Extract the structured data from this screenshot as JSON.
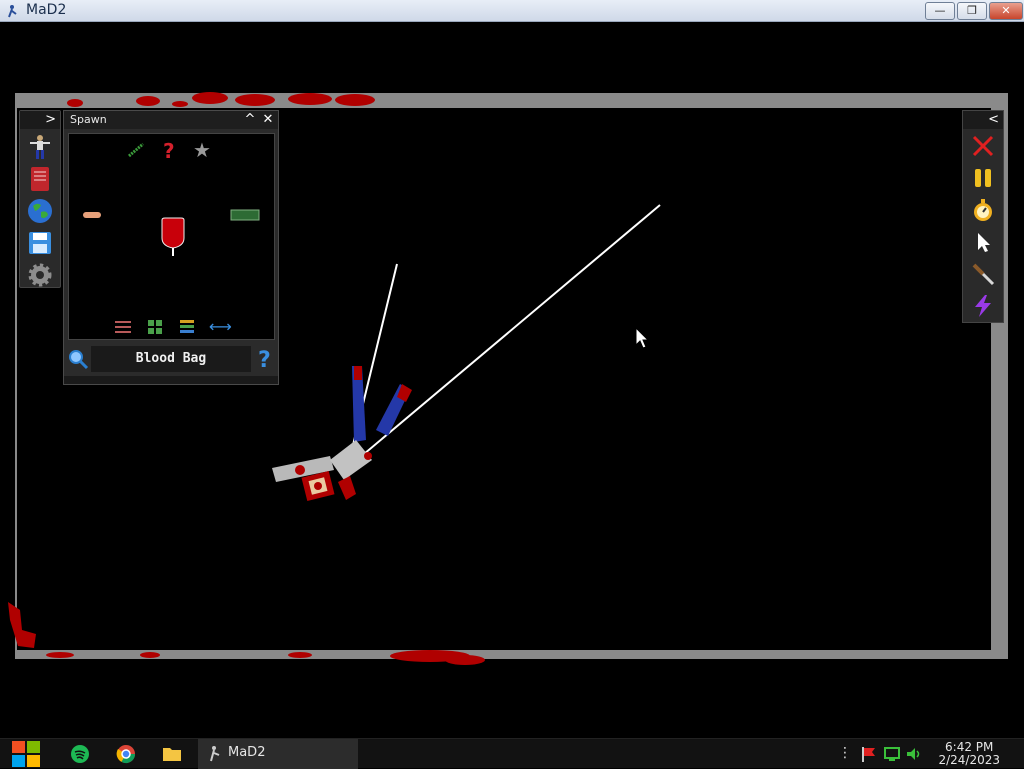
{
  "window": {
    "title": "MaD2",
    "buttons": {
      "minimize": "—",
      "restore": "❐",
      "close": "✕"
    }
  },
  "spawn_panel": {
    "title": "Spawn",
    "collapse_label": "^",
    "close_label": "✕",
    "selected_item": "Blood Bag",
    "top_icons": [
      "syringe-icon",
      "question-icon",
      "star-icon"
    ],
    "items": [
      "bandage-item",
      "blood-bag-item",
      "circuit-board-item"
    ],
    "bottom_icons": [
      "sliders-icon",
      "grid-icon",
      "list-icon",
      "swap-icon"
    ],
    "search_icon": "magnifier-icon",
    "help_icon": "question-icon"
  },
  "left_toolbar": {
    "toggle_label": ">",
    "items": [
      "ragdoll-icon",
      "book-icon",
      "globe-icon",
      "save-icon",
      "gear-icon"
    ]
  },
  "right_toolbar": {
    "toggle_label": "<",
    "items": [
      "clear-icon",
      "pause-icon",
      "stopwatch-icon",
      "pointer-icon",
      "knife-icon",
      "lightning-icon"
    ]
  },
  "taskbar": {
    "app_label": "MaD2",
    "time": "6:42 PM",
    "date": "2/24/2023"
  },
  "colors": {
    "arena_border": "#8a8a8a",
    "blood": "#b00000",
    "panel": "#2b2b2b"
  }
}
